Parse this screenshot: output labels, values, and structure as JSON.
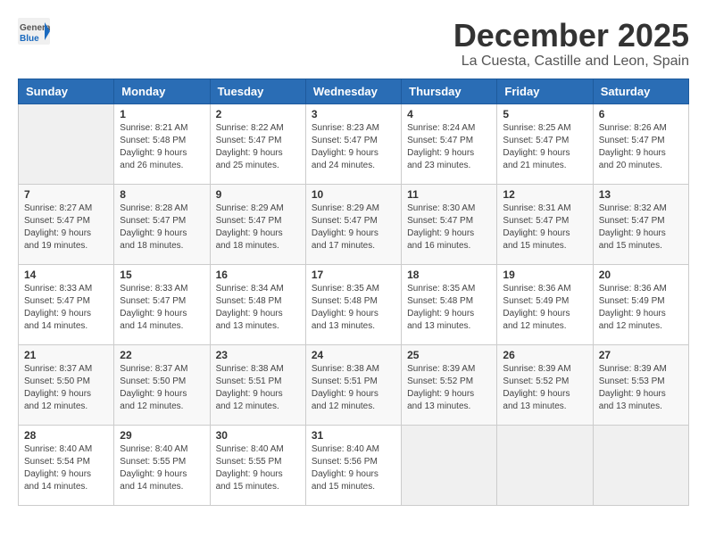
{
  "header": {
    "logo_general": "General",
    "logo_blue": "Blue",
    "month": "December 2025",
    "location": "La Cuesta, Castille and Leon, Spain"
  },
  "weekdays": [
    "Sunday",
    "Monday",
    "Tuesday",
    "Wednesday",
    "Thursday",
    "Friday",
    "Saturday"
  ],
  "weeks": [
    [
      {
        "day": "",
        "sunrise": "",
        "sunset": "",
        "daylight": ""
      },
      {
        "day": "1",
        "sunrise": "Sunrise: 8:21 AM",
        "sunset": "Sunset: 5:48 PM",
        "daylight": "Daylight: 9 hours and 26 minutes."
      },
      {
        "day": "2",
        "sunrise": "Sunrise: 8:22 AM",
        "sunset": "Sunset: 5:47 PM",
        "daylight": "Daylight: 9 hours and 25 minutes."
      },
      {
        "day": "3",
        "sunrise": "Sunrise: 8:23 AM",
        "sunset": "Sunset: 5:47 PM",
        "daylight": "Daylight: 9 hours and 24 minutes."
      },
      {
        "day": "4",
        "sunrise": "Sunrise: 8:24 AM",
        "sunset": "Sunset: 5:47 PM",
        "daylight": "Daylight: 9 hours and 23 minutes."
      },
      {
        "day": "5",
        "sunrise": "Sunrise: 8:25 AM",
        "sunset": "Sunset: 5:47 PM",
        "daylight": "Daylight: 9 hours and 21 minutes."
      },
      {
        "day": "6",
        "sunrise": "Sunrise: 8:26 AM",
        "sunset": "Sunset: 5:47 PM",
        "daylight": "Daylight: 9 hours and 20 minutes."
      }
    ],
    [
      {
        "day": "7",
        "sunrise": "Sunrise: 8:27 AM",
        "sunset": "Sunset: 5:47 PM",
        "daylight": "Daylight: 9 hours and 19 minutes."
      },
      {
        "day": "8",
        "sunrise": "Sunrise: 8:28 AM",
        "sunset": "Sunset: 5:47 PM",
        "daylight": "Daylight: 9 hours and 18 minutes."
      },
      {
        "day": "9",
        "sunrise": "Sunrise: 8:29 AM",
        "sunset": "Sunset: 5:47 PM",
        "daylight": "Daylight: 9 hours and 18 minutes."
      },
      {
        "day": "10",
        "sunrise": "Sunrise: 8:29 AM",
        "sunset": "Sunset: 5:47 PM",
        "daylight": "Daylight: 9 hours and 17 minutes."
      },
      {
        "day": "11",
        "sunrise": "Sunrise: 8:30 AM",
        "sunset": "Sunset: 5:47 PM",
        "daylight": "Daylight: 9 hours and 16 minutes."
      },
      {
        "day": "12",
        "sunrise": "Sunrise: 8:31 AM",
        "sunset": "Sunset: 5:47 PM",
        "daylight": "Daylight: 9 hours and 15 minutes."
      },
      {
        "day": "13",
        "sunrise": "Sunrise: 8:32 AM",
        "sunset": "Sunset: 5:47 PM",
        "daylight": "Daylight: 9 hours and 15 minutes."
      }
    ],
    [
      {
        "day": "14",
        "sunrise": "Sunrise: 8:33 AM",
        "sunset": "Sunset: 5:47 PM",
        "daylight": "Daylight: 9 hours and 14 minutes."
      },
      {
        "day": "15",
        "sunrise": "Sunrise: 8:33 AM",
        "sunset": "Sunset: 5:47 PM",
        "daylight": "Daylight: 9 hours and 14 minutes."
      },
      {
        "day": "16",
        "sunrise": "Sunrise: 8:34 AM",
        "sunset": "Sunset: 5:48 PM",
        "daylight": "Daylight: 9 hours and 13 minutes."
      },
      {
        "day": "17",
        "sunrise": "Sunrise: 8:35 AM",
        "sunset": "Sunset: 5:48 PM",
        "daylight": "Daylight: 9 hours and 13 minutes."
      },
      {
        "day": "18",
        "sunrise": "Sunrise: 8:35 AM",
        "sunset": "Sunset: 5:48 PM",
        "daylight": "Daylight: 9 hours and 13 minutes."
      },
      {
        "day": "19",
        "sunrise": "Sunrise: 8:36 AM",
        "sunset": "Sunset: 5:49 PM",
        "daylight": "Daylight: 9 hours and 12 minutes."
      },
      {
        "day": "20",
        "sunrise": "Sunrise: 8:36 AM",
        "sunset": "Sunset: 5:49 PM",
        "daylight": "Daylight: 9 hours and 12 minutes."
      }
    ],
    [
      {
        "day": "21",
        "sunrise": "Sunrise: 8:37 AM",
        "sunset": "Sunset: 5:50 PM",
        "daylight": "Daylight: 9 hours and 12 minutes."
      },
      {
        "day": "22",
        "sunrise": "Sunrise: 8:37 AM",
        "sunset": "Sunset: 5:50 PM",
        "daylight": "Daylight: 9 hours and 12 minutes."
      },
      {
        "day": "23",
        "sunrise": "Sunrise: 8:38 AM",
        "sunset": "Sunset: 5:51 PM",
        "daylight": "Daylight: 9 hours and 12 minutes."
      },
      {
        "day": "24",
        "sunrise": "Sunrise: 8:38 AM",
        "sunset": "Sunset: 5:51 PM",
        "daylight": "Daylight: 9 hours and 12 minutes."
      },
      {
        "day": "25",
        "sunrise": "Sunrise: 8:39 AM",
        "sunset": "Sunset: 5:52 PM",
        "daylight": "Daylight: 9 hours and 13 minutes."
      },
      {
        "day": "26",
        "sunrise": "Sunrise: 8:39 AM",
        "sunset": "Sunset: 5:52 PM",
        "daylight": "Daylight: 9 hours and 13 minutes."
      },
      {
        "day": "27",
        "sunrise": "Sunrise: 8:39 AM",
        "sunset": "Sunset: 5:53 PM",
        "daylight": "Daylight: 9 hours and 13 minutes."
      }
    ],
    [
      {
        "day": "28",
        "sunrise": "Sunrise: 8:40 AM",
        "sunset": "Sunset: 5:54 PM",
        "daylight": "Daylight: 9 hours and 14 minutes."
      },
      {
        "day": "29",
        "sunrise": "Sunrise: 8:40 AM",
        "sunset": "Sunset: 5:55 PM",
        "daylight": "Daylight: 9 hours and 14 minutes."
      },
      {
        "day": "30",
        "sunrise": "Sunrise: 8:40 AM",
        "sunset": "Sunset: 5:55 PM",
        "daylight": "Daylight: 9 hours and 15 minutes."
      },
      {
        "day": "31",
        "sunrise": "Sunrise: 8:40 AM",
        "sunset": "Sunset: 5:56 PM",
        "daylight": "Daylight: 9 hours and 15 minutes."
      },
      {
        "day": "",
        "sunrise": "",
        "sunset": "",
        "daylight": ""
      },
      {
        "day": "",
        "sunrise": "",
        "sunset": "",
        "daylight": ""
      },
      {
        "day": "",
        "sunrise": "",
        "sunset": "",
        "daylight": ""
      }
    ]
  ]
}
